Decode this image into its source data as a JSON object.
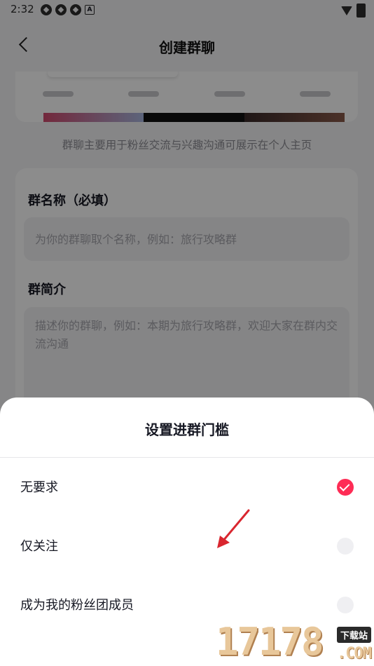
{
  "status_bar": {
    "time": "2:32",
    "notification_icons": [
      "app-notification-icon",
      "app-notification-icon",
      "app-notification-icon",
      "a-notification-icon"
    ],
    "right_icons": [
      "wifi-icon",
      "battery-charging-icon"
    ]
  },
  "header": {
    "back_icon": "chevron-left-icon",
    "title": "创建群聊"
  },
  "preview": {
    "tip": "群聊主要用于粉丝交流与兴趣沟通可展示在个人主页"
  },
  "form": {
    "name_label": "群名称（必填）",
    "name_placeholder": "为你的群聊取个名称，例如：旅行攻略群",
    "intro_label": "群简介",
    "intro_placeholder": "描述你的群聊，例如：本期为旅行攻略群，欢迎大家在群内交流沟通"
  },
  "sheet": {
    "title": "设置进群门槛",
    "options": [
      {
        "label": "无要求",
        "selected": true
      },
      {
        "label": "仅关注",
        "selected": false
      },
      {
        "label": "成为我的粉丝团成员",
        "selected": false
      }
    ]
  },
  "watermark": {
    "digits": "17178",
    "tag": "下载站",
    "domain": ".COM"
  },
  "colors": {
    "accent": "#fe2c55",
    "annotation_arrow": "#d9262f"
  }
}
